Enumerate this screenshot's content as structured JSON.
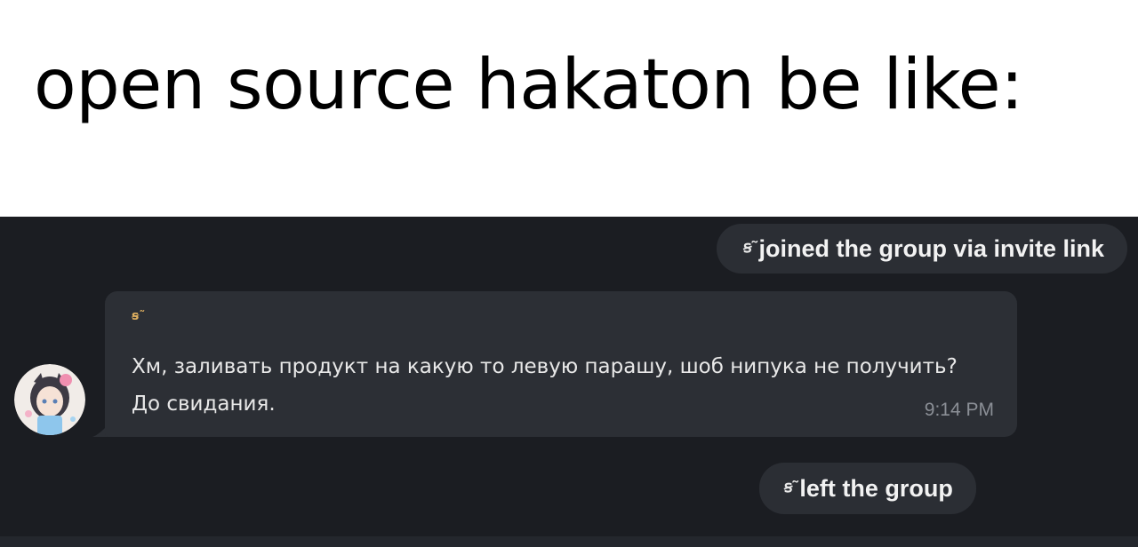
{
  "caption": {
    "text": "open source hakaton be like:"
  },
  "chat": {
    "service_joined": {
      "name_glyph": "ꞩ˜",
      "text": "joined the group via invite link"
    },
    "message": {
      "sender_name": "ꞩ˜",
      "text": "Хм, заливать продукт на какую то левую парашу, шоб нипука не получить? До свидания.",
      "time": "9:14 PM",
      "avatar_icon": "anime-girl-avatar"
    },
    "service_left": {
      "name_glyph": "ꞩ˜",
      "text": "left the group"
    }
  },
  "colors": {
    "caption_bg": "#ffffff",
    "chat_bg": "#1b1d22",
    "bubble_bg": "#2c2f35",
    "pill_bg": "#2b2e34",
    "name_accent": "#e0b060",
    "time_color": "#8b8f96"
  }
}
